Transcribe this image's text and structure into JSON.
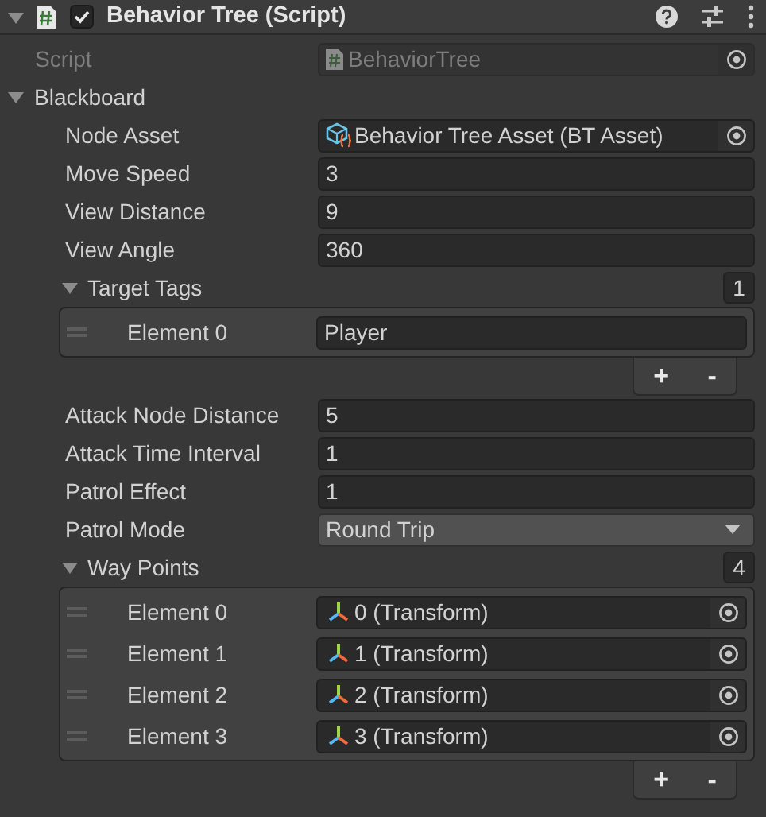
{
  "component": {
    "title": "Behavior Tree (Script)",
    "expanded": true,
    "enabled": true
  },
  "script_field": {
    "label": "Script",
    "value": "BehaviorTree",
    "disabled": true
  },
  "blackboard": {
    "label": "Blackboard",
    "expanded": true,
    "fields": [
      {
        "kind": "object",
        "label": "Node Asset",
        "value": "Behavior Tree Asset (BT Asset)"
      },
      {
        "kind": "number",
        "label": "Move Speed",
        "value": "3"
      },
      {
        "kind": "number",
        "label": "View Distance",
        "value": "9"
      },
      {
        "kind": "number",
        "label": "View Angle",
        "value": "360"
      },
      {
        "kind": "list",
        "label": "Target Tags",
        "count": "1",
        "expanded": true,
        "items": [
          {
            "kind": "text",
            "label": "Element 0",
            "value": "Player"
          }
        ],
        "footer_buttons": [
          "+",
          "-"
        ]
      },
      {
        "kind": "number",
        "label": "Attack Node Distance",
        "value": "5"
      },
      {
        "kind": "number",
        "label": "Attack Time Interval",
        "value": "1"
      },
      {
        "kind": "number",
        "label": "Patrol Effect",
        "value": "1"
      },
      {
        "kind": "dropdown",
        "label": "Patrol Mode",
        "value": "Round Trip"
      },
      {
        "kind": "list",
        "label": "Way Points",
        "count": "4",
        "expanded": true,
        "items": [
          {
            "kind": "transform",
            "label": "Element 0",
            "value": "0 (Transform)"
          },
          {
            "kind": "transform",
            "label": "Element 1",
            "value": "1 (Transform)"
          },
          {
            "kind": "transform",
            "label": "Element 2",
            "value": "2 (Transform)"
          },
          {
            "kind": "transform",
            "label": "Element 3",
            "value": "3 (Transform)"
          }
        ],
        "footer_buttons": [
          "+",
          "-"
        ]
      }
    ]
  }
}
